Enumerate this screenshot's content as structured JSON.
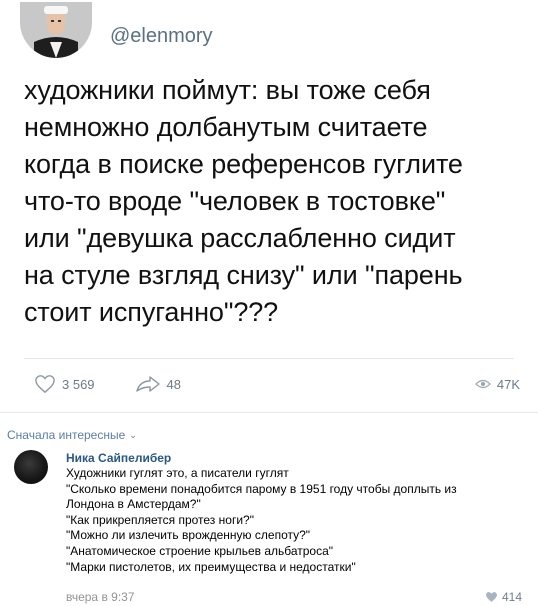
{
  "tweet": {
    "handle": "@elenmory",
    "lines": [
      "художники поймут: вы тоже себя",
      "немножно долбанутым считаете",
      "когда в поиске референсов гуглите",
      "что-то вроде \"человек в тостовке\"",
      "или \"девушка расслабленно сидит",
      "на стуле взгляд снизу\" или \"парень",
      "стоит испуганно\"???"
    ],
    "likes": "3 569",
    "retweets": "48",
    "views": "47K"
  },
  "comments_section": {
    "sort_label": "Сначала интересные",
    "comment": {
      "author": "Ника Сайпелибер",
      "lines": [
        "Художники гуглят это, а писатели гуглят",
        "\"Сколько времени понадобится парому в 1951 году чтобы доплыть из",
        "Лондона в Амстердам?\"",
        "\"Как прикрепляется протез ноги?\"",
        "\"Можно ли излечить врожденную слепоту?\"",
        "\"Анатомическое строение крыльев альбатроса\"",
        "\"Марки пистолетов, их преимущества и недостатки\""
      ],
      "time": "вчера в 9:37",
      "likes": "414"
    }
  },
  "colors": {
    "link": "#2a5885",
    "muted": "#939393",
    "icon": "#6e7a86"
  },
  "icons": [
    "heart-outline-icon",
    "share-arrow-icon",
    "eye-icon",
    "chevron-down-icon",
    "heart-filled-icon"
  ]
}
